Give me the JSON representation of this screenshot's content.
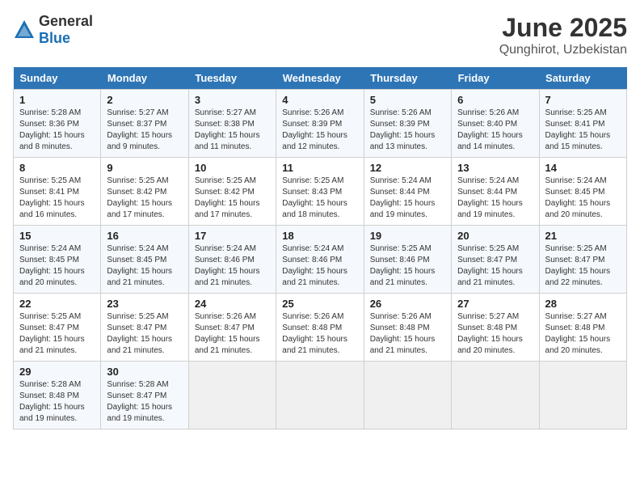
{
  "logo": {
    "general": "General",
    "blue": "Blue"
  },
  "title": "June 2025",
  "subtitle": "Qunghirot, Uzbekistan",
  "days_of_week": [
    "Sunday",
    "Monday",
    "Tuesday",
    "Wednesday",
    "Thursday",
    "Friday",
    "Saturday"
  ],
  "weeks": [
    [
      {
        "day": "1",
        "sunrise": "5:28 AM",
        "sunset": "8:36 PM",
        "daylight": "15 hours and 8 minutes."
      },
      {
        "day": "2",
        "sunrise": "5:27 AM",
        "sunset": "8:37 PM",
        "daylight": "15 hours and 9 minutes."
      },
      {
        "day": "3",
        "sunrise": "5:27 AM",
        "sunset": "8:38 PM",
        "daylight": "15 hours and 11 minutes."
      },
      {
        "day": "4",
        "sunrise": "5:26 AM",
        "sunset": "8:39 PM",
        "daylight": "15 hours and 12 minutes."
      },
      {
        "day": "5",
        "sunrise": "5:26 AM",
        "sunset": "8:39 PM",
        "daylight": "15 hours and 13 minutes."
      },
      {
        "day": "6",
        "sunrise": "5:26 AM",
        "sunset": "8:40 PM",
        "daylight": "15 hours and 14 minutes."
      },
      {
        "day": "7",
        "sunrise": "5:25 AM",
        "sunset": "8:41 PM",
        "daylight": "15 hours and 15 minutes."
      }
    ],
    [
      {
        "day": "8",
        "sunrise": "5:25 AM",
        "sunset": "8:41 PM",
        "daylight": "15 hours and 16 minutes."
      },
      {
        "day": "9",
        "sunrise": "5:25 AM",
        "sunset": "8:42 PM",
        "daylight": "15 hours and 17 minutes."
      },
      {
        "day": "10",
        "sunrise": "5:25 AM",
        "sunset": "8:42 PM",
        "daylight": "15 hours and 17 minutes."
      },
      {
        "day": "11",
        "sunrise": "5:25 AM",
        "sunset": "8:43 PM",
        "daylight": "15 hours and 18 minutes."
      },
      {
        "day": "12",
        "sunrise": "5:24 AM",
        "sunset": "8:44 PM",
        "daylight": "15 hours and 19 minutes."
      },
      {
        "day": "13",
        "sunrise": "5:24 AM",
        "sunset": "8:44 PM",
        "daylight": "15 hours and 19 minutes."
      },
      {
        "day": "14",
        "sunrise": "5:24 AM",
        "sunset": "8:45 PM",
        "daylight": "15 hours and 20 minutes."
      }
    ],
    [
      {
        "day": "15",
        "sunrise": "5:24 AM",
        "sunset": "8:45 PM",
        "daylight": "15 hours and 20 minutes."
      },
      {
        "day": "16",
        "sunrise": "5:24 AM",
        "sunset": "8:45 PM",
        "daylight": "15 hours and 21 minutes."
      },
      {
        "day": "17",
        "sunrise": "5:24 AM",
        "sunset": "8:46 PM",
        "daylight": "15 hours and 21 minutes."
      },
      {
        "day": "18",
        "sunrise": "5:24 AM",
        "sunset": "8:46 PM",
        "daylight": "15 hours and 21 minutes."
      },
      {
        "day": "19",
        "sunrise": "5:25 AM",
        "sunset": "8:46 PM",
        "daylight": "15 hours and 21 minutes."
      },
      {
        "day": "20",
        "sunrise": "5:25 AM",
        "sunset": "8:47 PM",
        "daylight": "15 hours and 21 minutes."
      },
      {
        "day": "21",
        "sunrise": "5:25 AM",
        "sunset": "8:47 PM",
        "daylight": "15 hours and 22 minutes."
      }
    ],
    [
      {
        "day": "22",
        "sunrise": "5:25 AM",
        "sunset": "8:47 PM",
        "daylight": "15 hours and 21 minutes."
      },
      {
        "day": "23",
        "sunrise": "5:25 AM",
        "sunset": "8:47 PM",
        "daylight": "15 hours and 21 minutes."
      },
      {
        "day": "24",
        "sunrise": "5:26 AM",
        "sunset": "8:47 PM",
        "daylight": "15 hours and 21 minutes."
      },
      {
        "day": "25",
        "sunrise": "5:26 AM",
        "sunset": "8:48 PM",
        "daylight": "15 hours and 21 minutes."
      },
      {
        "day": "26",
        "sunrise": "5:26 AM",
        "sunset": "8:48 PM",
        "daylight": "15 hours and 21 minutes."
      },
      {
        "day": "27",
        "sunrise": "5:27 AM",
        "sunset": "8:48 PM",
        "daylight": "15 hours and 20 minutes."
      },
      {
        "day": "28",
        "sunrise": "5:27 AM",
        "sunset": "8:48 PM",
        "daylight": "15 hours and 20 minutes."
      }
    ],
    [
      {
        "day": "29",
        "sunrise": "5:28 AM",
        "sunset": "8:48 PM",
        "daylight": "15 hours and 19 minutes."
      },
      {
        "day": "30",
        "sunrise": "5:28 AM",
        "sunset": "8:47 PM",
        "daylight": "15 hours and 19 minutes."
      },
      null,
      null,
      null,
      null,
      null
    ]
  ],
  "labels": {
    "sunrise": "Sunrise:",
    "sunset": "Sunset:",
    "daylight": "Daylight:"
  }
}
